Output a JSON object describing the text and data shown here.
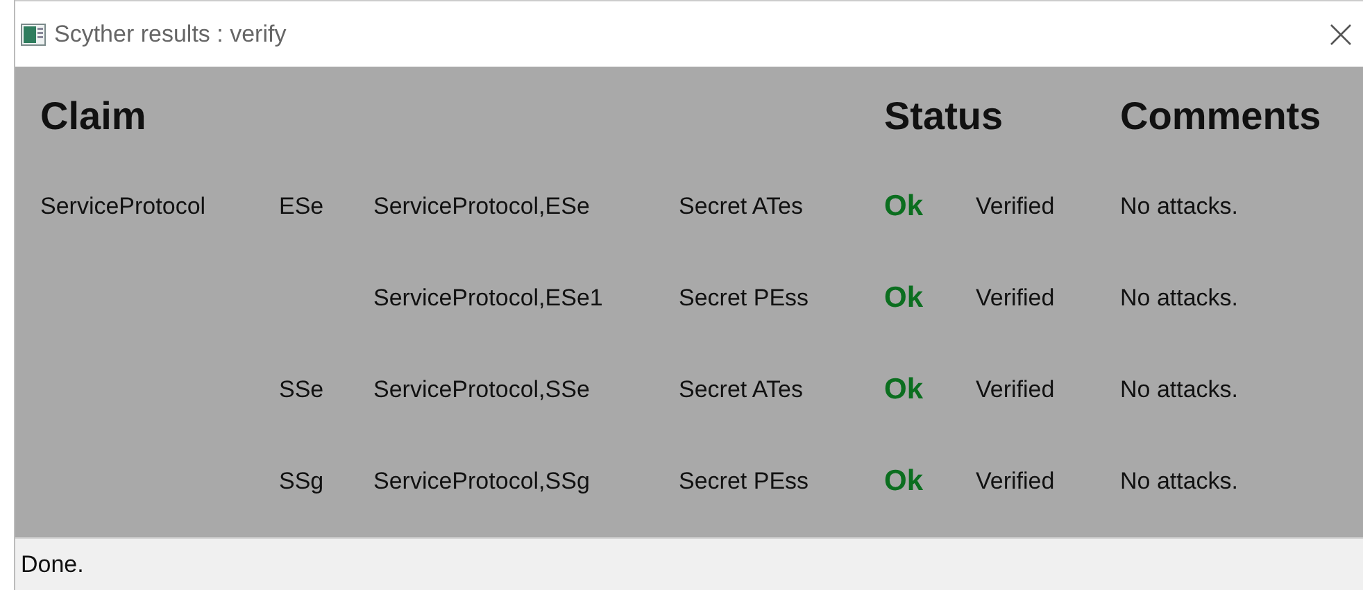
{
  "window": {
    "title": "Scyther results : verify"
  },
  "table": {
    "columns": [
      "Claim",
      "Status",
      "Comments"
    ],
    "rows": [
      {
        "protocol": "ServiceProtocol",
        "role": "ESe",
        "label": "ServiceProtocol,ESe",
        "claim": "Secret ATes",
        "status": "Ok",
        "verdict": "Verified",
        "comment": "No attacks."
      },
      {
        "label": "ServiceProtocol,ESe1",
        "claim": "Secret PEss",
        "status": "Ok",
        "verdict": "Verified",
        "comment": "No attacks."
      },
      {
        "role": "SSe",
        "label": "ServiceProtocol,SSe",
        "claim": "Secret ATes",
        "status": "Ok",
        "verdict": "Verified",
        "comment": "No attacks."
      },
      {
        "role": "SSg",
        "label": "ServiceProtocol,SSg",
        "claim": "Secret PEss",
        "status": "Ok",
        "verdict": "Verified",
        "comment": "No attacks."
      }
    ]
  },
  "status_bar": "Done."
}
